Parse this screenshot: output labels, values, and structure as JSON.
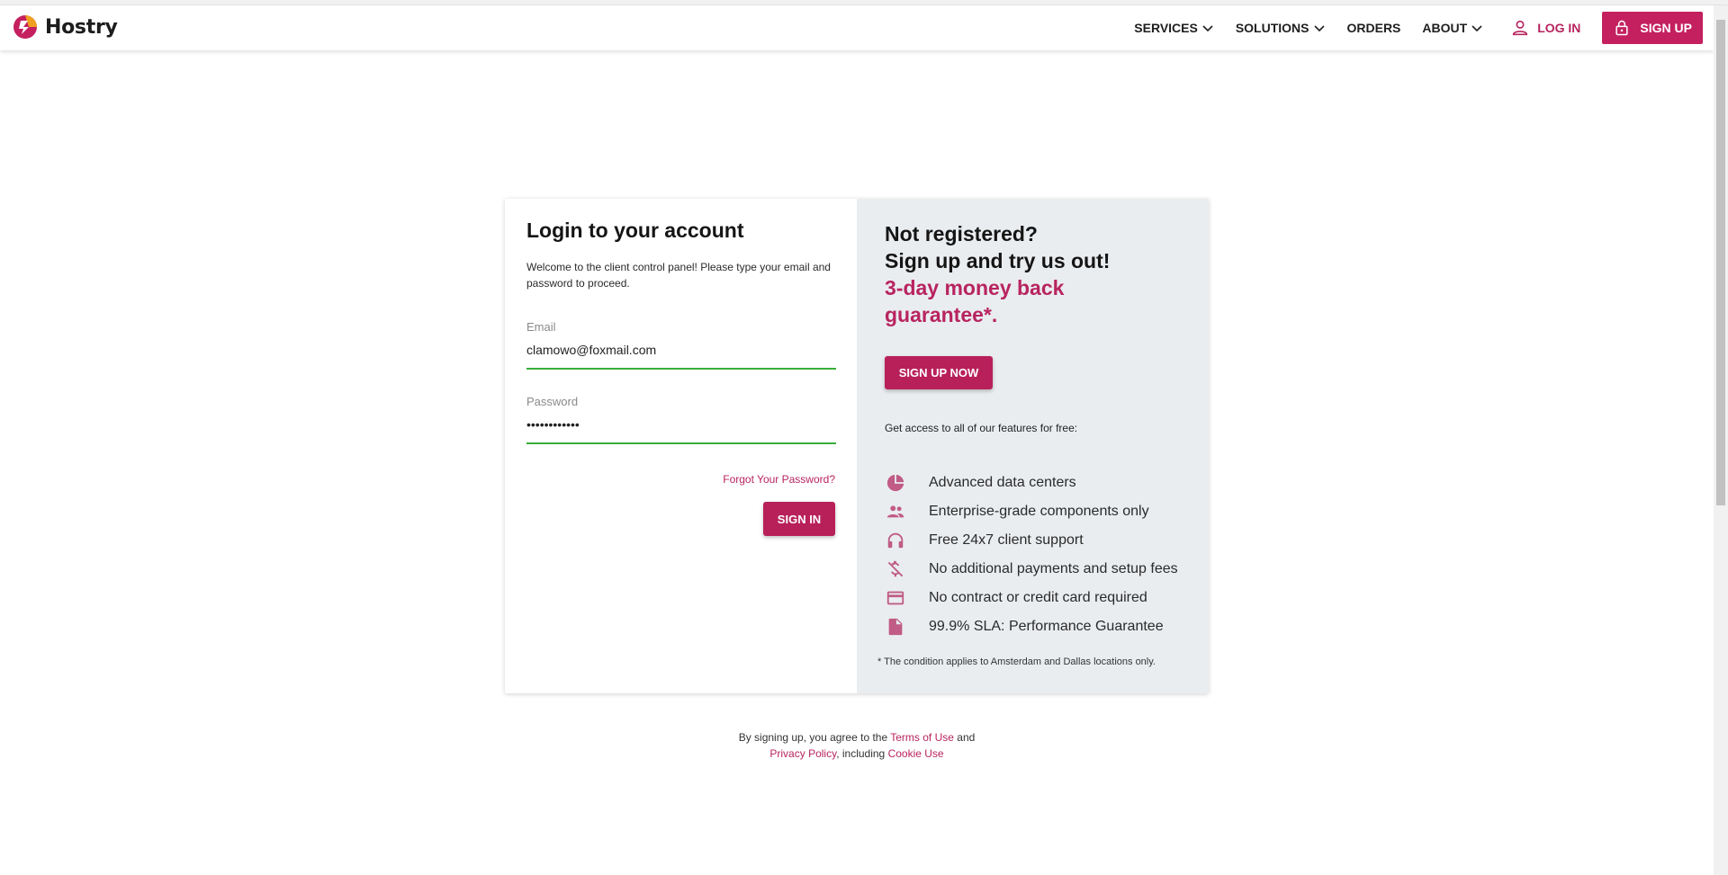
{
  "header": {
    "brand": "Hostry",
    "nav": [
      {
        "label": "SERVICES",
        "dropdown": true
      },
      {
        "label": "SOLUTIONS",
        "dropdown": true
      },
      {
        "label": "ORDERS",
        "dropdown": false
      },
      {
        "label": "ABOUT",
        "dropdown": true
      }
    ],
    "login_label": "LOG IN",
    "signup_label": "SIGN UP"
  },
  "login": {
    "title": "Login to your account",
    "description": "Welcome to the client control panel! Please type your email and password to proceed.",
    "email_label": "Email",
    "email_value": "clamowo@foxmail.com",
    "password_label": "Password",
    "password_value": "••••••••••••",
    "forgot_label": "Forgot Your Password?",
    "signin_label": "SIGN IN"
  },
  "promo": {
    "line1": "Not registered?",
    "line2": "Sign up and try us out!",
    "accent": "3-day money back guarantee*.",
    "signup_now_label": "SIGN UP NOW",
    "access_text": "Get access to all of our features for free:",
    "features": [
      {
        "icon": "pie-chart-icon",
        "label": "Advanced data centers"
      },
      {
        "icon": "people-icon",
        "label": "Enterprise-grade components only"
      },
      {
        "icon": "headset-icon",
        "label": "Free 24x7 client support"
      },
      {
        "icon": "no-money-icon",
        "label": "No additional payments and setup fees"
      },
      {
        "icon": "credit-card-icon",
        "label": "No contract or credit card required"
      },
      {
        "icon": "document-icon",
        "label": "99.9% SLA: Performance Guarantee"
      }
    ],
    "footnote": "* The condition applies to Amsterdam and Dallas locations only."
  },
  "terms": {
    "prefix": "By signing up, you agree to the ",
    "terms_link": "Terms of Use",
    "and": " and",
    "privacy_link": "Privacy Policy",
    "including": ", including ",
    "cookie_link": "Cookie Use"
  },
  "colors": {
    "brand": "#c4205f",
    "accent_text": "#b8245f",
    "input_focus": "#3aad3a",
    "promo_bg": "#eaedf0"
  }
}
